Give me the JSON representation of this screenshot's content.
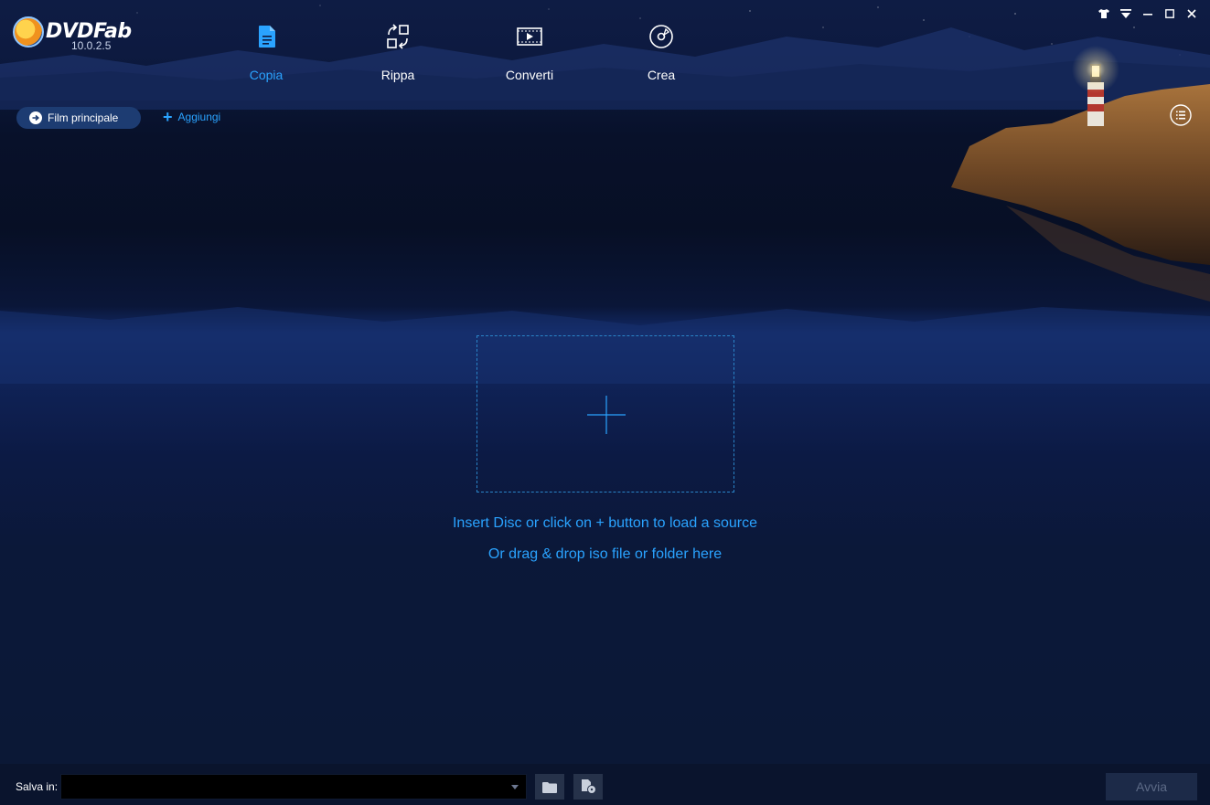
{
  "app": {
    "name": "DVDFab",
    "version": "10.0.2.5"
  },
  "nav": {
    "tabs": [
      {
        "label": "Copia",
        "icon": "copy-document-icon",
        "active": true
      },
      {
        "label": "Rippa",
        "icon": "ripper-icon",
        "active": false
      },
      {
        "label": "Converti",
        "icon": "film-convert-icon",
        "active": false
      },
      {
        "label": "Crea",
        "icon": "disc-creator-icon",
        "active": false
      }
    ]
  },
  "toolbar": {
    "mode_label": "Film principale",
    "add_label": "Aggiungi"
  },
  "main": {
    "hint_line1": "Insert Disc or click on + button to load a source",
    "hint_line2": "Or drag & drop iso file or folder here"
  },
  "bottom": {
    "save_label": "Salva in:",
    "save_path": "",
    "start_label": "Avvia"
  },
  "colors": {
    "accent": "#2aa3ff",
    "background": "#0c1735",
    "disabled_button": "#1c2a48"
  }
}
